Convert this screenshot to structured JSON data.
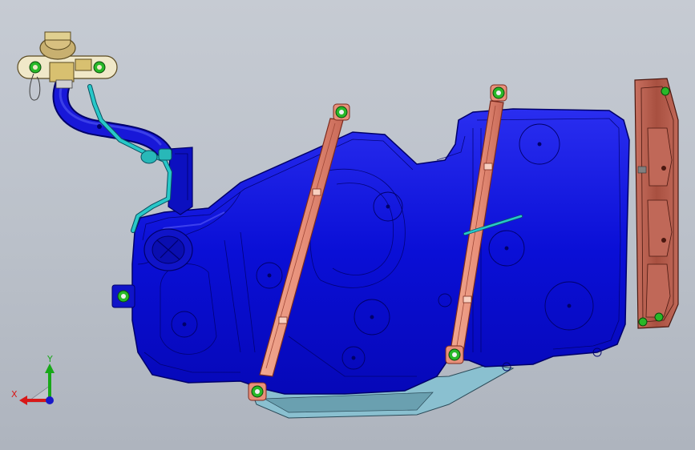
{
  "viewport": {
    "background_top": "#c6cbd3",
    "background_bottom": "#aeb4be"
  },
  "colors": {
    "tank_body": "#0a0fd6",
    "tank_edge": "#00006a",
    "tank_highlight": "#3a3ff0",
    "strap": "#e8907a",
    "strap_edge": "#7a2a1e",
    "bracket": "#b05848",
    "bracket_edge": "#4a1810",
    "hose": "#1818d8",
    "vent_line": "#28c8c8",
    "filler_cap": "#c8b878",
    "bolt": "#28b828",
    "skid_plate": "#7ab8c8"
  },
  "components": {
    "fuel_tank": "fuel-tank",
    "filler_neck": "filler-neck-hose",
    "filler_cap": "filler-cap-assembly",
    "vent_line": "vent-line",
    "strap_left": "tank-strap",
    "strap_right": "tank-strap",
    "mount_bracket": "mounting-bracket",
    "fuel_pump_flange": "pump-flange"
  },
  "triad": {
    "y_label": "Y",
    "x_label": "X",
    "y_color": "#18a818",
    "x_color": "#d81818",
    "z_color": "#1818c8"
  }
}
